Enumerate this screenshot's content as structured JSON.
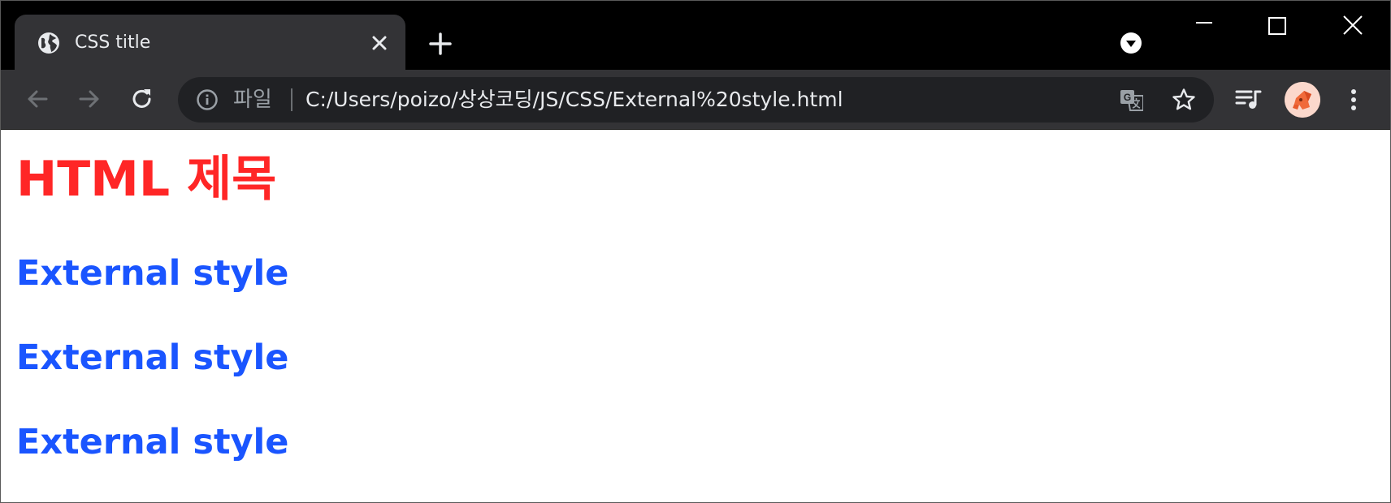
{
  "tab": {
    "favicon": "globe-icon",
    "title": "CSS title"
  },
  "window_controls": [
    "minimize-icon",
    "maximize-icon",
    "close-icon"
  ],
  "toolbar": {
    "nav": [
      "back-arrow-icon",
      "forward-arrow-icon",
      "reload-icon"
    ],
    "omnibox": {
      "scheme_label": "파일",
      "url": "C:/Users/poizo/상상코딩/JS/CSS/External%20style.html"
    },
    "icons": [
      "translate-icon",
      "bookmark-star-icon",
      "media-control-icon",
      "profile-avatar",
      "menu-icon"
    ]
  },
  "page": {
    "heading": "HTML 제목",
    "subheadings": [
      "External style",
      "External style",
      "External style"
    ]
  },
  "colors": {
    "heading": "#ff2626",
    "subheading": "#1a55ff",
    "tab_strip": "#000000",
    "toolbar": "#333336",
    "omnibox": "#202124"
  }
}
